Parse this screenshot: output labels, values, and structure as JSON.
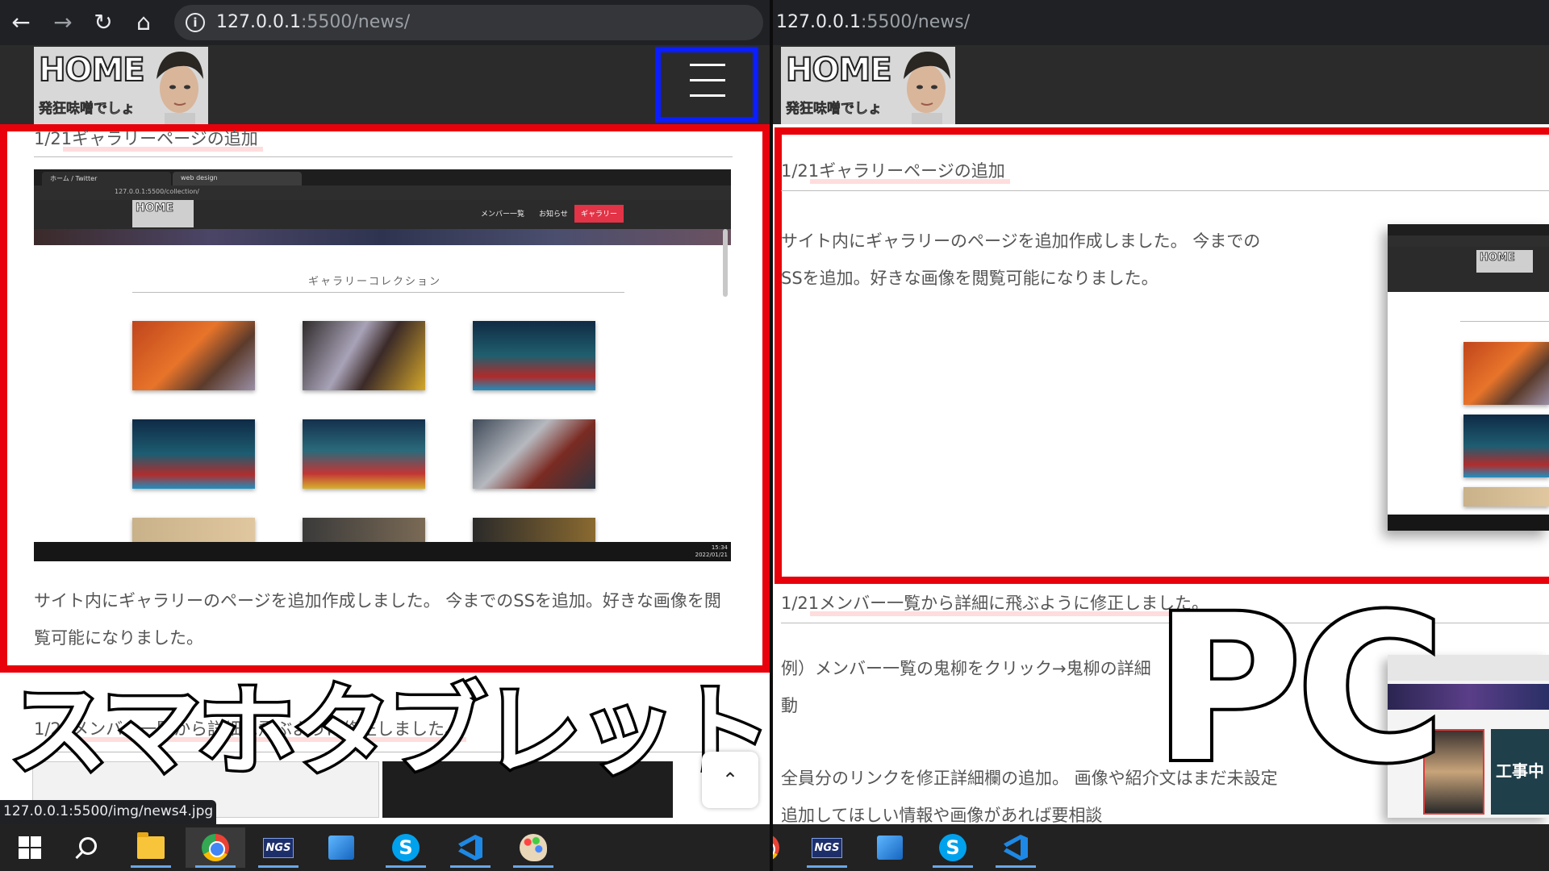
{
  "left_pane": {
    "url_host": "127.0.0.1",
    "url_path": ":5500/news/",
    "logo_home": "HOME",
    "logo_sub": "発狂味噌でしょ",
    "article1_title": "1/21ギャラリーページの追加",
    "article1_body": "サイト内にギャラリーのページを追加作成しました。 今までのSSを追加。好きな画像を閲覧可能になりました。",
    "article2_title": "1/21メンバー一覧から詳細に飛ぶように修正しました。",
    "overlay_label": "スマホタブレット",
    "status_tooltip": "127.0.0.1:5500/img/news4.jpg",
    "embed": {
      "tab1": "ホーム / Twitter",
      "tab2": "web design",
      "url": "127.0.0.1:5500/collection/",
      "logo": "HOME",
      "nav_members": "メンバー一覧",
      "nav_news": "お知らせ",
      "nav_gallery": "ギャラリー",
      "heading": "ギャラリーコレクション",
      "clock_time": "15:34",
      "clock_date": "2022/01/21"
    }
  },
  "right_pane": {
    "url_host": "127.0.0.1",
    "url_path": ":5500/news/",
    "logo_home": "HOME",
    "logo_sub": "発狂味噌でしょ",
    "article1_title": "1/21ギャラリーページの追加",
    "article1_body_line1": "サイト内にギャラリーのページを追加作成しました。 今までの",
    "article1_body_line2": "SSを追加。好きな画像を閲覧可能になりました。",
    "article2_title": "1/21メンバー一覧から詳細に飛ぶように修正しました。",
    "article2_body_line1": "例）メンバー一覧の鬼柳をクリック→鬼柳の詳細",
    "article2_body_line2": "動",
    "article2_body_line3": "全員分のリンクを修正詳細欄の追加。 画像や紹介文はまだ未設定",
    "article2_body_line4": "追加してほしい情報や画像があれば要相談",
    "overlay_label": "PC",
    "embed2_text": "工事中"
  },
  "colors": {
    "highlight_red": "#e8000b",
    "hamburger_blue": "#0a1eff",
    "gallery_button": "#e33346"
  }
}
